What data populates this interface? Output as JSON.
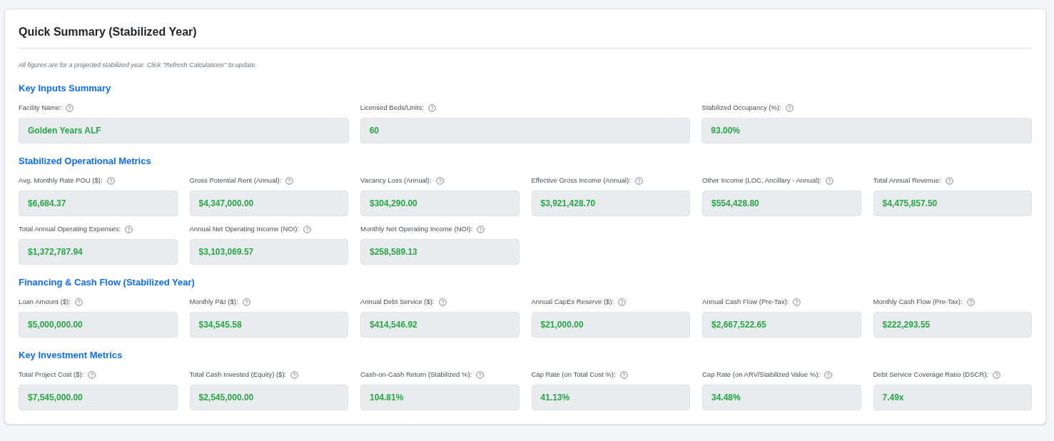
{
  "title": "Quick Summary (Stabilized Year)",
  "note": "All figures are for a projected stabilized year. Click \"Refresh Calculations\" to update.",
  "sections": [
    {
      "heading": "Key Inputs Summary",
      "kind": "wide",
      "fields": [
        {
          "label": "Facility Name:",
          "value": "Golden Years ALF"
        },
        {
          "label": "Licensed Beds/Units:",
          "value": "60"
        },
        {
          "label": "Stabilized Occupancy (%):",
          "value": "93.00%"
        }
      ]
    },
    {
      "heading": "Stabilized Operational Metrics",
      "kind": "compact",
      "fields": [
        {
          "label": "Avg. Monthly Rate POU ($):",
          "value": "$6,684.37"
        },
        {
          "label": "Gross Potential Rent (Annual):",
          "value": "$4,347,000.00"
        },
        {
          "label": "Vacancy Loss (Annual):",
          "value": "$304,290.00"
        },
        {
          "label": "Effective Gross Income (Annual):",
          "value": "$3,921,428.70"
        },
        {
          "label": "Other Income (LOC, Ancillary - Annual):",
          "value": "$554,428.80"
        },
        {
          "label": "Total Annual Revenue:",
          "value": "$4,475,857.50"
        },
        {
          "label": "Total Annual Operating Expenses:",
          "value": "$1,372,787.94"
        },
        {
          "label": "Annual Net Operating Income (NOI):",
          "value": "$3,103,069.57"
        },
        {
          "label": "Monthly Net Operating Income (NOI):",
          "value": "$258,589.13"
        }
      ]
    },
    {
      "heading": "Financing & Cash Flow (Stabilized Year)",
      "kind": "compact",
      "fields": [
        {
          "label": "Loan Amount ($):",
          "value": "$5,000,000.00"
        },
        {
          "label": "Monthly P&I ($):",
          "value": "$34,545.58"
        },
        {
          "label": "Annual Debt Service ($):",
          "value": "$414,546.92"
        },
        {
          "label": "Annual CapEx Reserve ($):",
          "value": "$21,000.00"
        },
        {
          "label": "Annual Cash Flow (Pre-Tax):",
          "value": "$2,667,522.65"
        },
        {
          "label": "Monthly Cash Flow (Pre-Tax):",
          "value": "$222,293.55"
        }
      ]
    },
    {
      "heading": "Key Investment Metrics",
      "kind": "compact",
      "fields": [
        {
          "label": "Total Project Cost ($):",
          "value": "$7,545,000.00"
        },
        {
          "label": "Total Cash Invested (Equity) ($):",
          "value": "$2,545,000.00"
        },
        {
          "label": "Cash-on-Cash Return (Stabilized %):",
          "value": "104.81%"
        },
        {
          "label": "Cap Rate (on Total Cost %):",
          "value": "41.13%"
        },
        {
          "label": "Cap Rate (on ARV/Stabilized Value %):",
          "value": "34.48%"
        },
        {
          "label": "Debt Service Coverage Ratio (DSCR):",
          "value": "7.49x"
        }
      ]
    }
  ]
}
